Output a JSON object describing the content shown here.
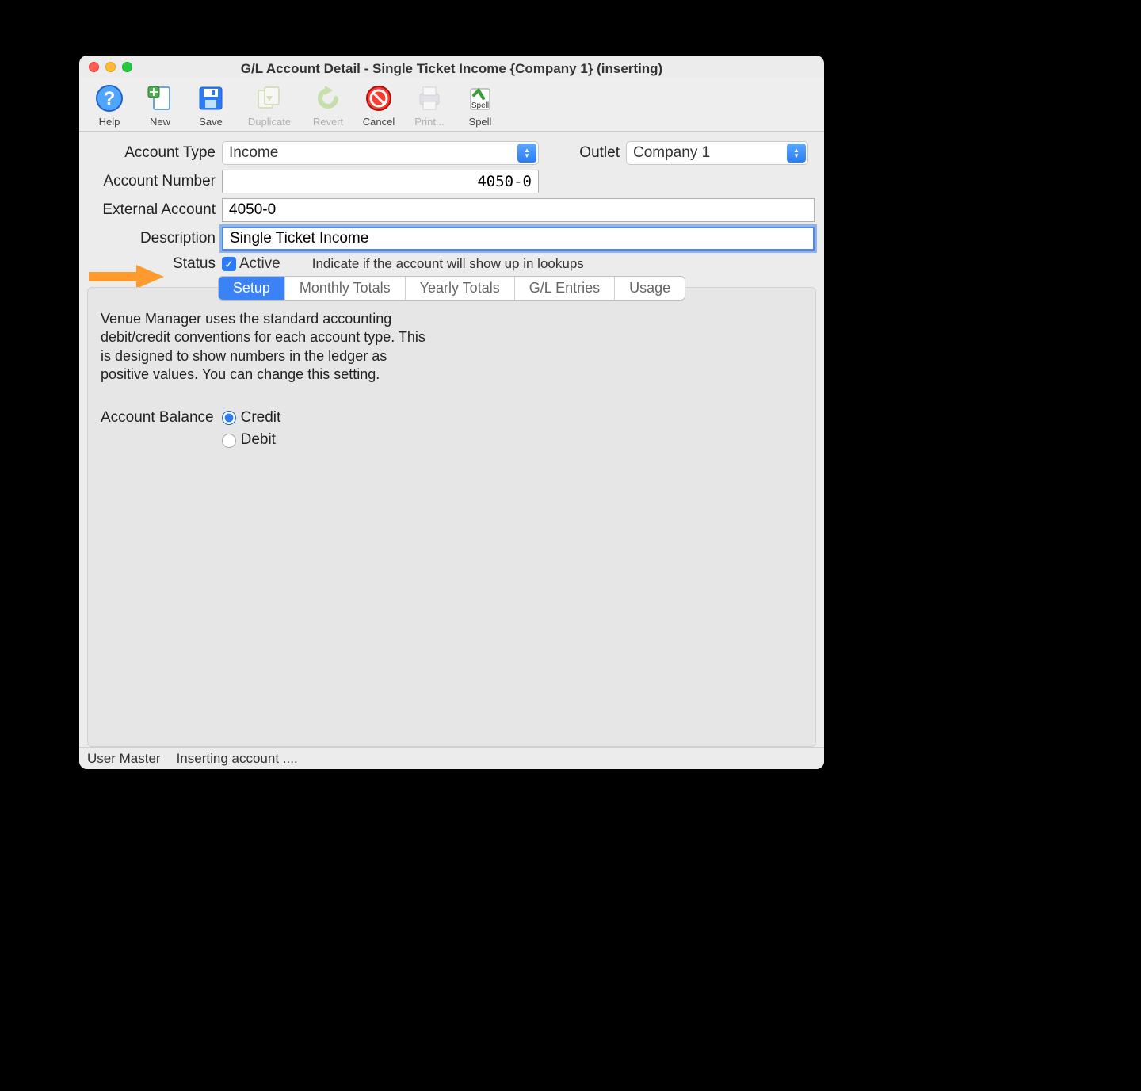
{
  "window": {
    "title": "G/L Account Detail - Single Ticket Income {Company 1} (inserting)"
  },
  "toolbar": {
    "help": "Help",
    "new": "New",
    "save": "Save",
    "duplicate": "Duplicate",
    "revert": "Revert",
    "cancel": "Cancel",
    "print": "Print...",
    "spell": "Spell"
  },
  "form": {
    "account_type_label": "Account Type",
    "account_type_value": "Income",
    "outlet_label": "Outlet",
    "outlet_value": "Company 1",
    "account_number_label": "Account Number",
    "account_number_value": "4050-0",
    "external_account_label": "External Account",
    "external_account_value": "4050-0",
    "description_label": "Description",
    "description_value": "Single Ticket Income",
    "status_label": "Status",
    "status_checkbox_label": "Active",
    "status_hint": "Indicate if the account will show up in lookups"
  },
  "tabs": {
    "setup": "Setup",
    "monthly": "Monthly Totals",
    "yearly": "Yearly Totals",
    "gl": "G/L Entries",
    "usage": "Usage"
  },
  "setup_tab": {
    "info": "Venue Manager uses the standard accounting debit/credit conventions for each account type. This is designed to show numbers in the ledger as positive values.   You can change this setting.",
    "balance_label": "Account Balance",
    "credit": "Credit",
    "debit": "Debit"
  },
  "statusbar": {
    "user": "User Master",
    "msg": "Inserting account ...."
  }
}
